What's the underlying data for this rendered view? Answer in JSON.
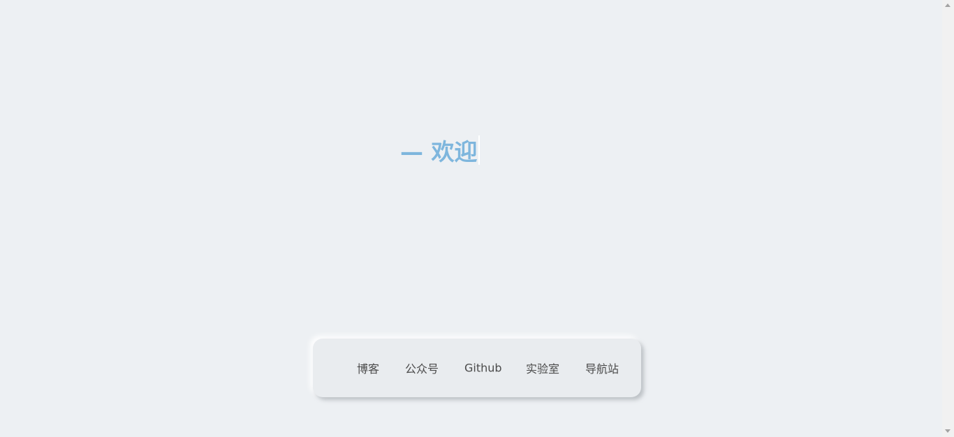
{
  "hero": {
    "text": "— 欢迎"
  },
  "nav": {
    "items": [
      {
        "label": "博客"
      },
      {
        "label": "公众号"
      },
      {
        "label": "Github"
      },
      {
        "label": "实验室"
      },
      {
        "label": "导航站"
      }
    ]
  },
  "colors": {
    "background": "#edf0f3",
    "accent": "#7eb6dd",
    "link": "#4a4a4a"
  }
}
